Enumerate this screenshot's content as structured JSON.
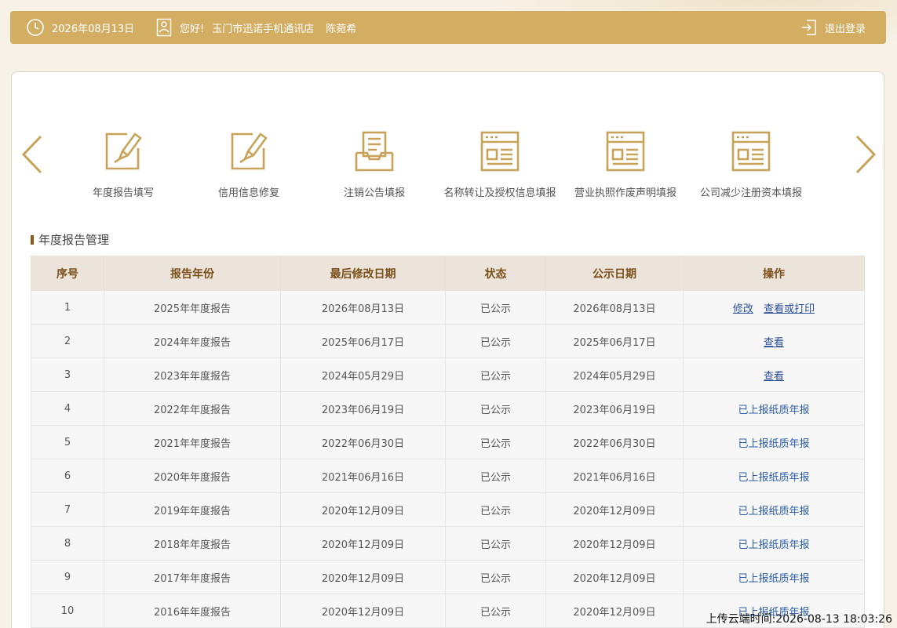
{
  "header": {
    "date": "2026年08月13日",
    "greeting": "您好!",
    "store_name": "玉门市迅诺手机通讯店",
    "user_name": "陈菀希",
    "logout_label": "退出登录"
  },
  "nav": {
    "items": [
      {
        "label": "年度报告填写",
        "icon": "form-edit-icon"
      },
      {
        "label": "信用信息修复",
        "icon": "form-edit-icon"
      },
      {
        "label": "注销公告填报",
        "icon": "inbox-document-icon"
      },
      {
        "label": "名称转让及授权信息填报",
        "icon": "document-list-icon"
      },
      {
        "label": "营业执照作废声明填报",
        "icon": "document-list-icon"
      },
      {
        "label": "公司减少注册资本填报",
        "icon": "document-list-icon"
      }
    ]
  },
  "section": {
    "title": "年度报告管理"
  },
  "table": {
    "headers": [
      "序号",
      "报告年份",
      "最后修改日期",
      "状态",
      "公示日期",
      "操作"
    ],
    "rows": [
      {
        "no": "1",
        "year": "2025年年度报告",
        "modified": "2026年08月13日",
        "status": "已公示",
        "published": "2026年08月13日",
        "actions": [
          "修改",
          "查看或打印"
        ]
      },
      {
        "no": "2",
        "year": "2024年年度报告",
        "modified": "2025年06月17日",
        "status": "已公示",
        "published": "2025年06月17日",
        "actions": [
          "查看"
        ]
      },
      {
        "no": "3",
        "year": "2023年年度报告",
        "modified": "2024年05月29日",
        "status": "已公示",
        "published": "2024年05月29日",
        "actions": [
          "查看"
        ]
      },
      {
        "no": "4",
        "year": "2022年年度报告",
        "modified": "2023年06月19日",
        "status": "已公示",
        "published": "2023年06月19日",
        "note": "已上报纸质年报"
      },
      {
        "no": "5",
        "year": "2021年年度报告",
        "modified": "2022年06月30日",
        "status": "已公示",
        "published": "2022年06月30日",
        "note": "已上报纸质年报"
      },
      {
        "no": "6",
        "year": "2020年年度报告",
        "modified": "2021年06月16日",
        "status": "已公示",
        "published": "2021年06月16日",
        "note": "已上报纸质年报"
      },
      {
        "no": "7",
        "year": "2019年年度报告",
        "modified": "2020年12月09日",
        "status": "已公示",
        "published": "2020年12月09日",
        "note": "已上报纸质年报"
      },
      {
        "no": "8",
        "year": "2018年年度报告",
        "modified": "2020年12月09日",
        "status": "已公示",
        "published": "2020年12月09日",
        "note": "已上报纸质年报"
      },
      {
        "no": "9",
        "year": "2017年年度报告",
        "modified": "2020年12月09日",
        "status": "已公示",
        "published": "2020年12月09日",
        "note": "已上报纸质年报"
      },
      {
        "no": "10",
        "year": "2016年年度报告",
        "modified": "2020年12月09日",
        "status": "已公示",
        "published": "2020年12月09日",
        "note": "已上报纸质年报"
      }
    ]
  },
  "footer": {
    "upload_time": "上传云端时间:2026-08-13 18:03:26"
  },
  "colors": {
    "topbar": "#d3ad62",
    "accent": "#c9a259",
    "link": "#2b4f9a"
  }
}
